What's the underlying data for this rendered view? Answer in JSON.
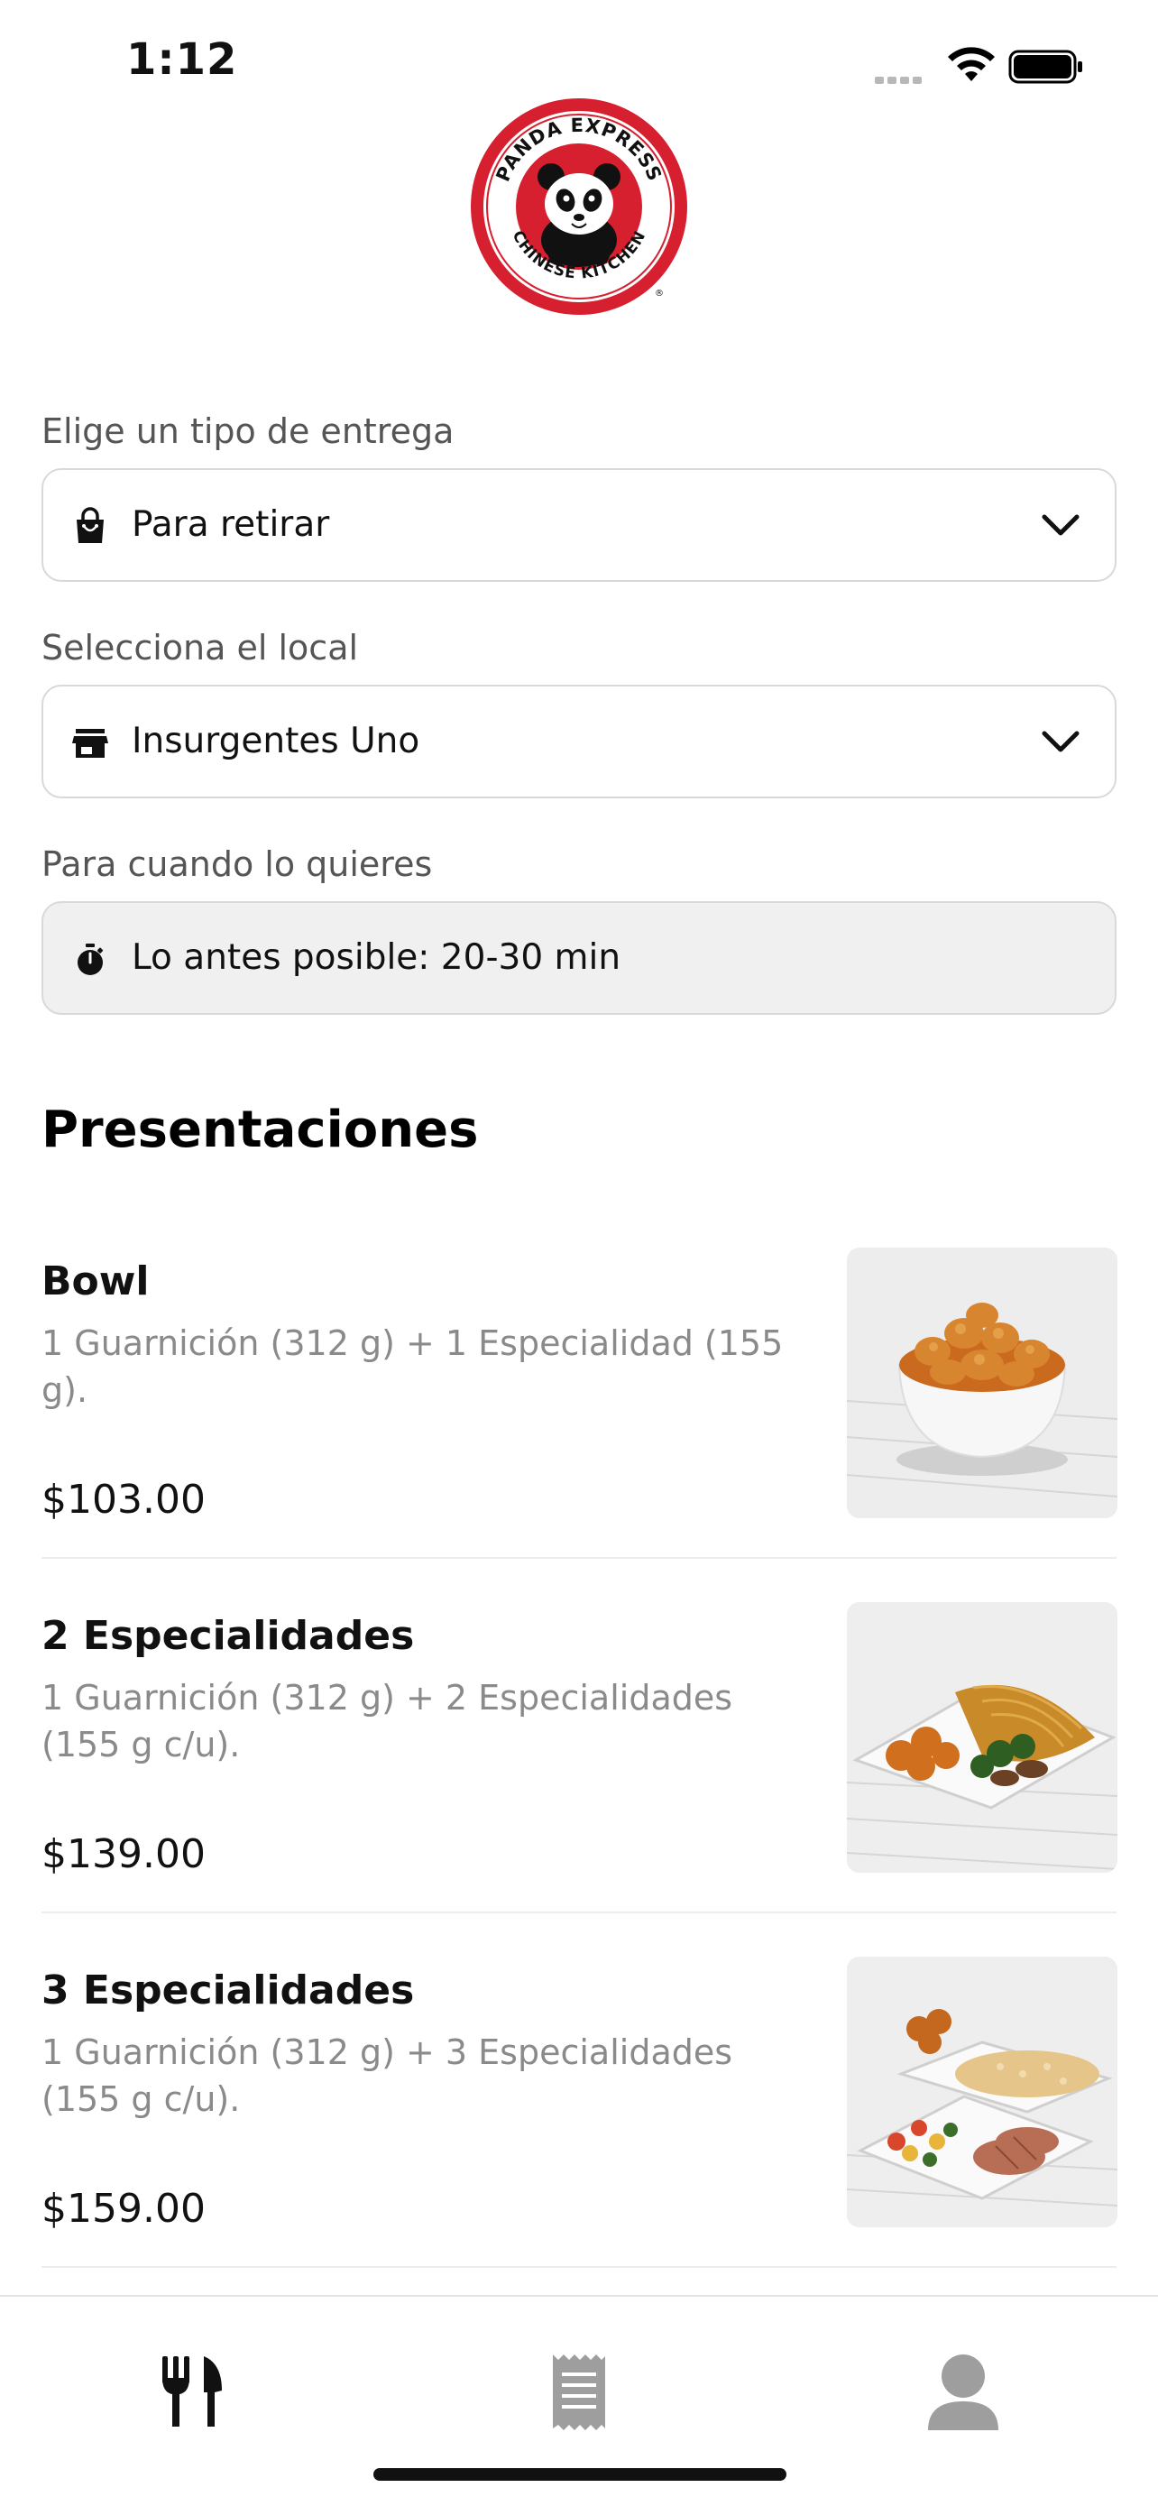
{
  "status_bar": {
    "time": "1:12"
  },
  "brand": {
    "logo_text_top": "PANDA EXPRESS",
    "logo_text_bottom": "CHINESE KITCHEN",
    "accent_color": "#d6202f"
  },
  "delivery": {
    "label": "Elige un tipo de entrega",
    "value": "Para retirar",
    "icon": "shopping-bag-icon"
  },
  "store": {
    "label": "Selecciona el local",
    "value": "Insurgentes Uno",
    "icon": "store-icon"
  },
  "schedule": {
    "label": "Para cuando lo quieres",
    "value": "Lo antes posible: 20-30 min",
    "icon": "stopwatch-icon"
  },
  "menu": {
    "title": "Presentaciones",
    "items": [
      {
        "name": "Bowl",
        "description": "1 Guarnición (312 g) + 1 Especialidad (155 g).",
        "price": "$103.00"
      },
      {
        "name": "2 Especialidades",
        "description": "1 Guarnición (312 g) + 2 Especialidades (155 g c/u).",
        "price": "$139.00"
      },
      {
        "name": "3 Especialidades",
        "description": "1 Guarnición (312 g) + 3 Especialidades (155 g c/u).",
        "price": "$159.00"
      }
    ]
  },
  "tab_bar": {
    "tabs": [
      {
        "icon": "fork-knife-icon",
        "active": true
      },
      {
        "icon": "receipt-icon",
        "active": false
      },
      {
        "icon": "person-icon",
        "active": false
      }
    ]
  }
}
